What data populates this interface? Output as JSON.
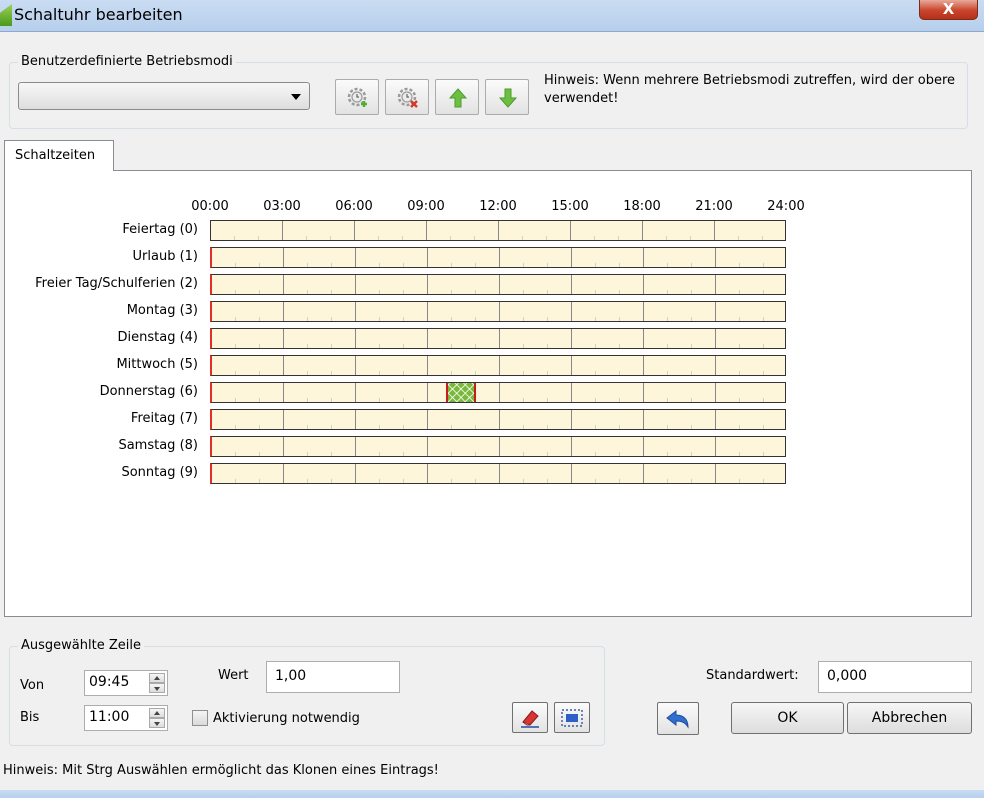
{
  "window": {
    "title": "Schaltuhr bearbeiten",
    "close_label": "X"
  },
  "modes": {
    "legend": "Benutzerdefinierte Betriebsmodi",
    "selected": "",
    "hint": "Hinweis: Wenn mehrere Betriebsmodi zutreffen, wird der obere verwendet!"
  },
  "tabs": [
    {
      "label": "Schaltzeiten"
    }
  ],
  "schedule": {
    "hours": [
      "00:00",
      "03:00",
      "06:00",
      "09:00",
      "12:00",
      "15:00",
      "18:00",
      "21:00",
      "24:00"
    ],
    "rows": [
      {
        "label": "Feiertag (0)"
      },
      {
        "label": "Urlaub (1)"
      },
      {
        "label": "Freier Tag/Schulferien (2)"
      },
      {
        "label": "Montag (3)"
      },
      {
        "label": "Dienstag (4)"
      },
      {
        "label": "Mittwoch (5)"
      },
      {
        "label": "Donnerstag (6)",
        "segment": {
          "start": "09:45",
          "end": "11:00"
        }
      },
      {
        "label": "Freitag (7)"
      },
      {
        "label": "Samstag (8)"
      },
      {
        "label": "Sonntag (9)"
      }
    ]
  },
  "selected_row": {
    "legend": "Ausgewählte Zeile",
    "von_label": "Von",
    "von_value": "09:45",
    "bis_label": "Bis",
    "bis_value": "11:00",
    "wert_label": "Wert",
    "wert_value": "1,00",
    "activation_label": "Aktivierung notwendig"
  },
  "standard": {
    "label": "Standardwert:",
    "value": "0,000"
  },
  "buttons": {
    "ok": "OK",
    "cancel": "Abbrechen"
  },
  "footer_hint": "Hinweis: Mit Strg Auswählen ermöglicht das Klonen eines Eintrags!",
  "colors": {
    "bar_fill": "#fdf6da",
    "segment": "#7ab83b",
    "marker": "#e0302a"
  },
  "icons": [
    "add-mode-icon",
    "delete-mode-icon",
    "move-up-icon",
    "move-down-icon",
    "eraser-icon",
    "select-range-icon",
    "undo-arrow-icon"
  ]
}
